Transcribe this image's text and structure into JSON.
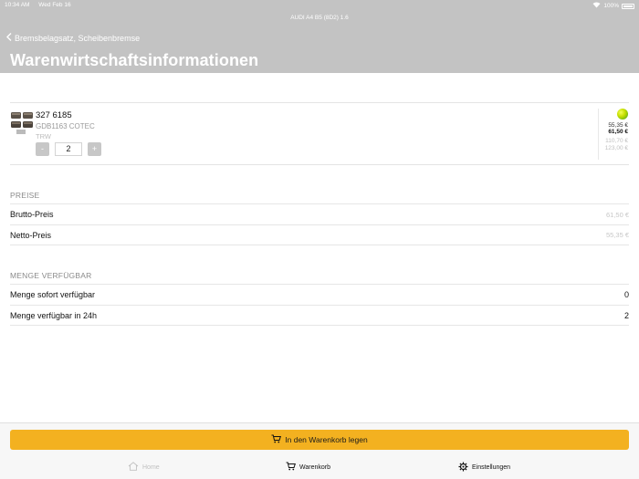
{
  "status_bar": {
    "time": "10:34 AM",
    "date": "Wed Feb 16",
    "battery": "100%"
  },
  "nav": {
    "vehicle_title": "AUDI A4 B5 (8D2) 1.6",
    "back_label": "Bremsbelagsatz, Scheibenbremse",
    "page_title": "Warenwirtschaftsinformationen"
  },
  "product": {
    "article_number": "327 6185",
    "description": "GDB1163 COTEC",
    "brand": "TRW",
    "quantity": "2",
    "minus_label": "-",
    "plus_label": "+",
    "prices": [
      "55,35 €",
      "61,50 €",
      "110,70 €",
      "123,00 €"
    ],
    "availability_color": "#7cc71a"
  },
  "prices_section": {
    "header": "PREISE",
    "rows": [
      {
        "label": "Brutto-Preis",
        "value": "61,50 €"
      },
      {
        "label": "Netto-Preis",
        "value": "55,35 €"
      }
    ]
  },
  "stock_section": {
    "header": "MENGE VERFÜGBAR",
    "rows": [
      {
        "label": "Menge sofort verfügbar",
        "value": "0"
      },
      {
        "label": "Menge verfügbar in 24h",
        "value": "2"
      }
    ]
  },
  "actions": {
    "add_to_cart": "In den Warenkorb legen"
  },
  "tabs": [
    {
      "label": "Home",
      "icon": "home-icon"
    },
    {
      "label": "Warenkorb",
      "icon": "cart-icon"
    },
    {
      "label": "Einstellungen",
      "icon": "gear-icon"
    }
  ],
  "colors": {
    "header_bg": "#c3c3c3",
    "accent": "#f3b120"
  }
}
